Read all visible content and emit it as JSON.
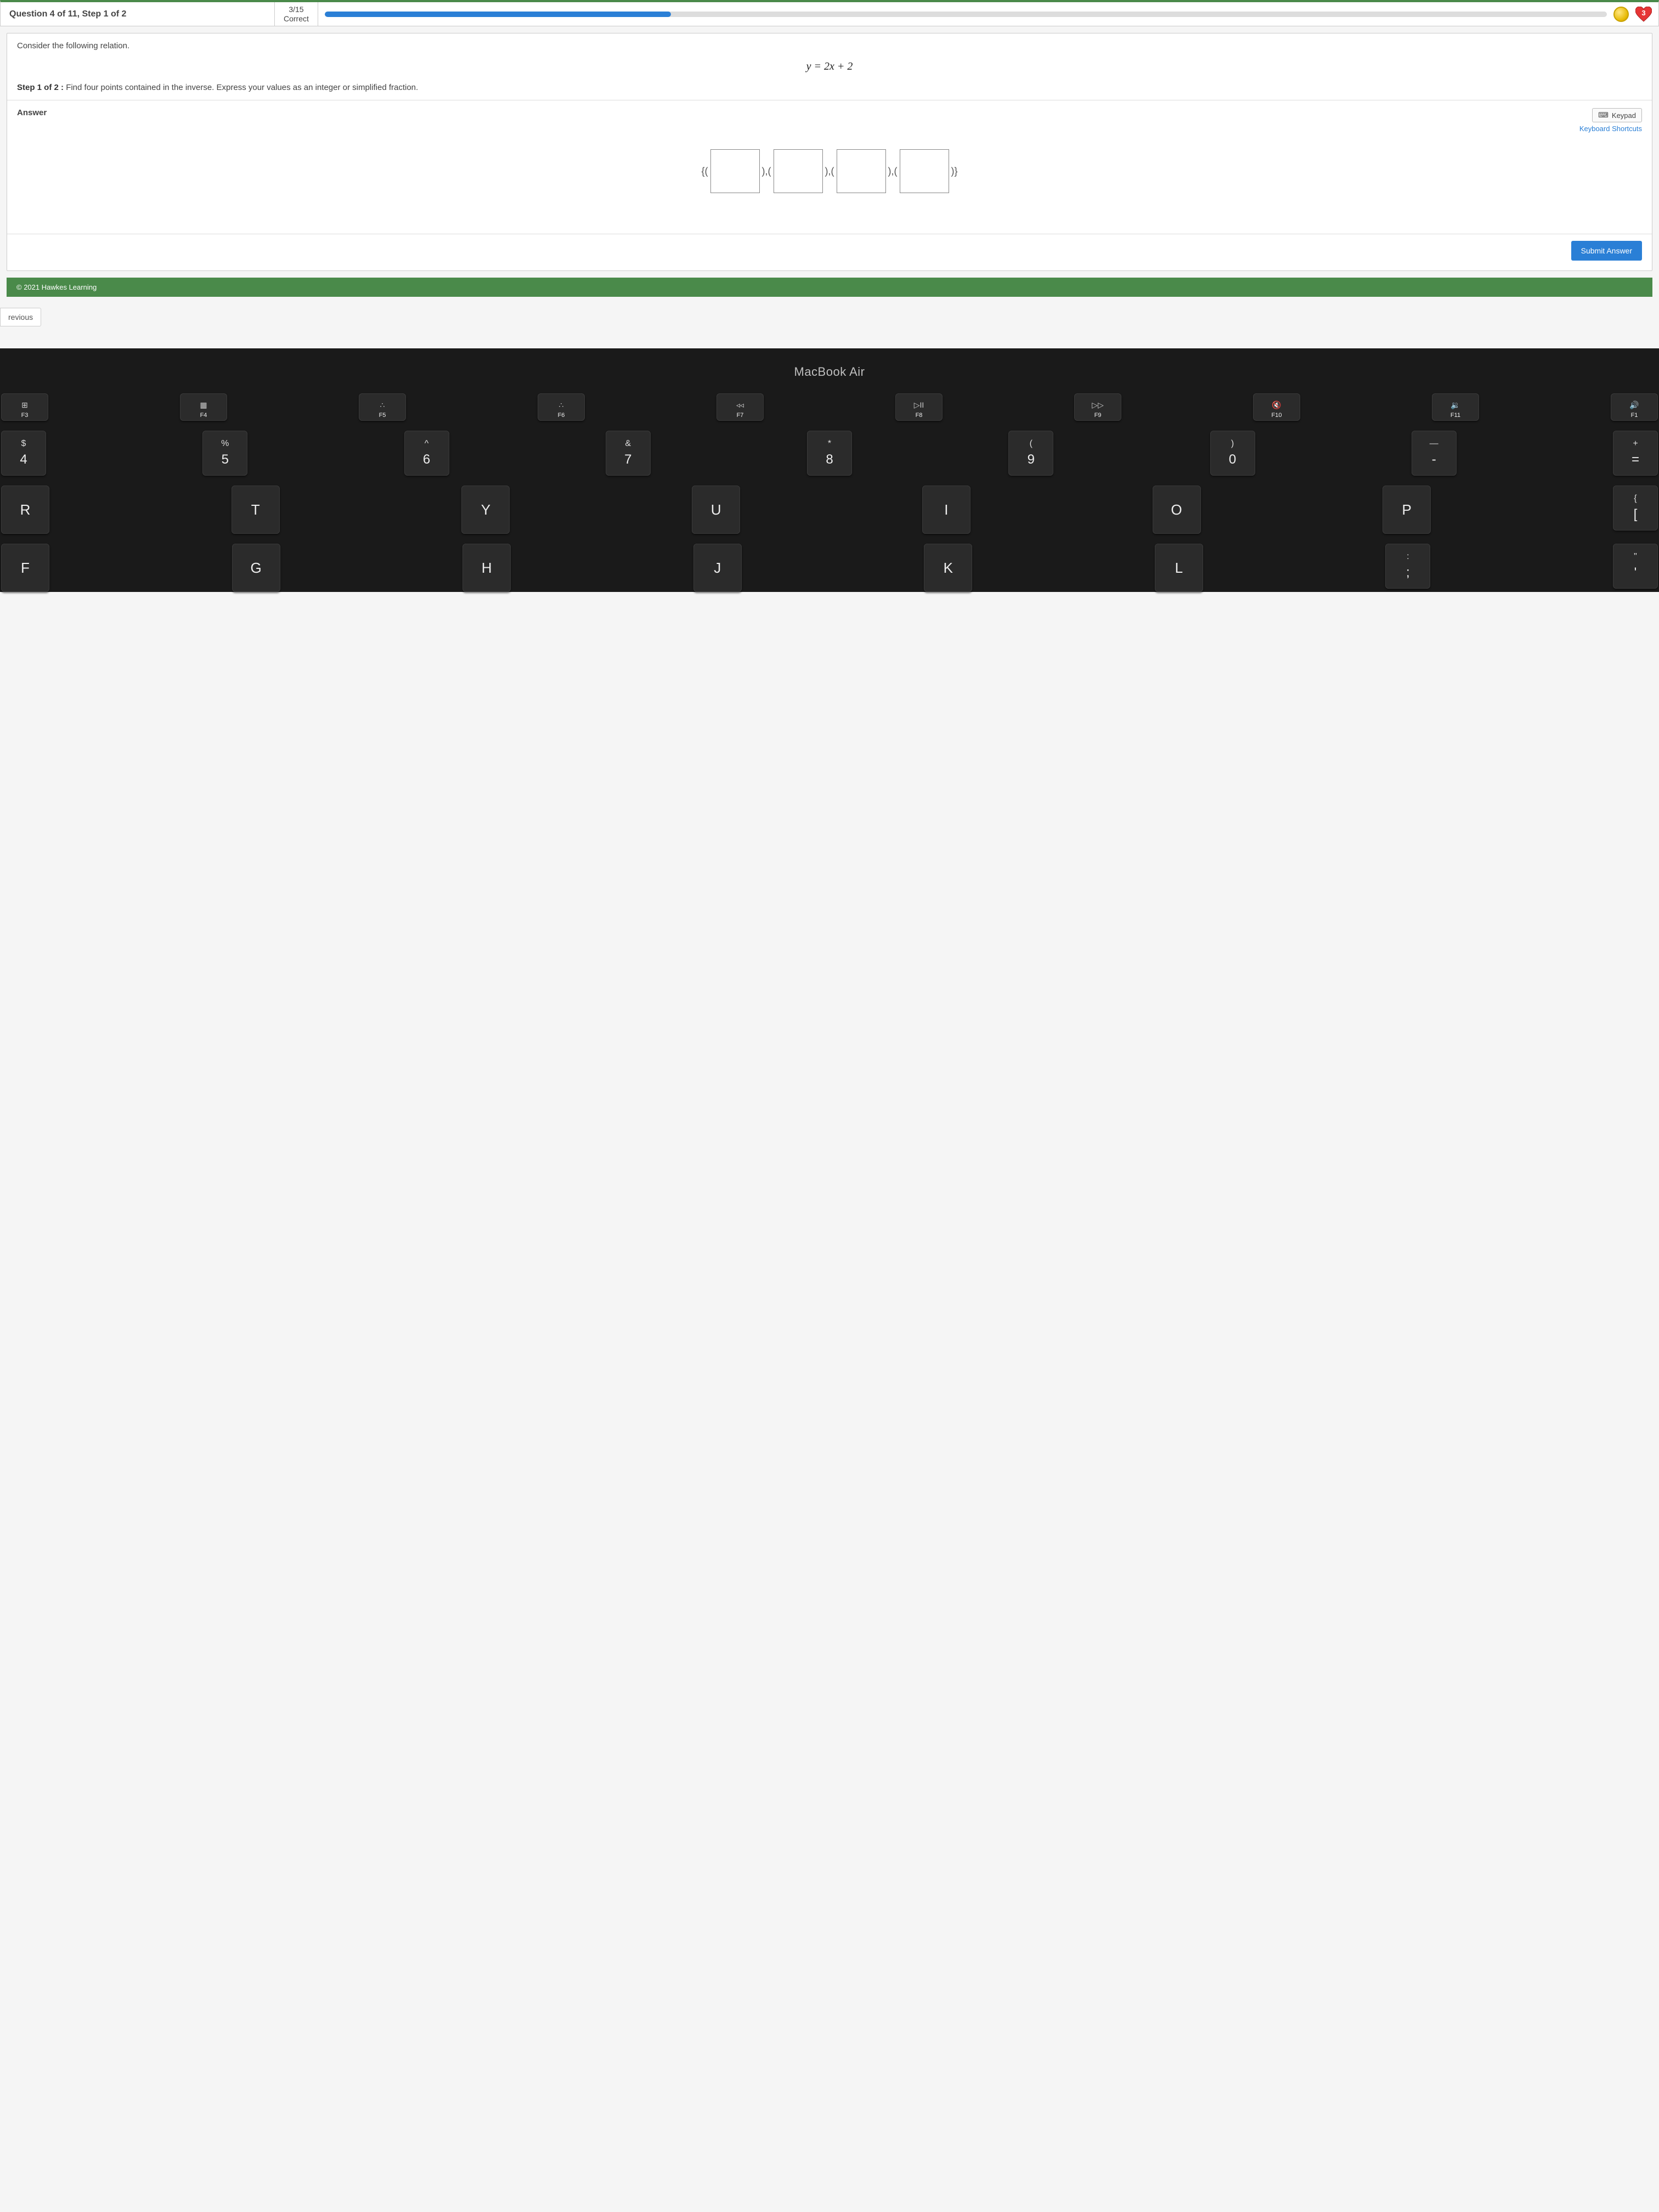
{
  "header": {
    "title": "Question 4 of 11, Step 1 of 2",
    "score_top": "3/15",
    "score_bottom": "Correct",
    "heart_count": "3"
  },
  "question": {
    "prompt": "Consider the following relation.",
    "equation": "y = 2x + 2",
    "step_label": "Step 1 of 2 :",
    "step_text": "Find four points contained in the inverse. Express your values as an integer or simplified fraction."
  },
  "answer": {
    "title": "Answer",
    "keypad_label": "Keypad",
    "shortcuts_label": "Keyboard Shortcuts",
    "open_brace": "{(",
    "sep": "),(",
    "close_brace": ")}",
    "submit_label": "Submit Answer"
  },
  "footer": {
    "copyright": "© 2021 Hawkes Learning",
    "previous": "revious"
  },
  "keyboard": {
    "brand": "MacBook Air",
    "fn_row": [
      {
        "icon": "⊞",
        "label": "F3"
      },
      {
        "icon": "▦",
        "label": "F4"
      },
      {
        "icon": "∴",
        "label": "F5"
      },
      {
        "icon": "∴",
        "label": "F6"
      },
      {
        "icon": "◃◃",
        "label": "F7"
      },
      {
        "icon": "▷II",
        "label": "F8"
      },
      {
        "icon": "▷▷",
        "label": "F9"
      },
      {
        "icon": "🔇",
        "label": "F10"
      },
      {
        "icon": "🔉",
        "label": "F11"
      },
      {
        "icon": "🔊",
        "label": "F1"
      }
    ],
    "num_row": [
      {
        "top": "$",
        "bot": "4"
      },
      {
        "top": "%",
        "bot": "5"
      },
      {
        "top": "^",
        "bot": "6"
      },
      {
        "top": "&",
        "bot": "7"
      },
      {
        "top": "*",
        "bot": "8"
      },
      {
        "top": "(",
        "bot": "9"
      },
      {
        "top": ")",
        "bot": "0"
      },
      {
        "top": "—",
        "bot": "-"
      },
      {
        "top": "+",
        "bot": "="
      }
    ],
    "row_q": [
      "R",
      "T",
      "Y",
      "U",
      "I",
      "O",
      "P"
    ],
    "row_q_extra": {
      "top": "{",
      "bot": "["
    },
    "row_a": [
      "F",
      "G",
      "H",
      "J",
      "K",
      "L"
    ],
    "row_a_extra1": {
      "top": ":",
      "bot": ";"
    },
    "row_a_extra2": {
      "top": "\"",
      "bot": "'"
    }
  }
}
